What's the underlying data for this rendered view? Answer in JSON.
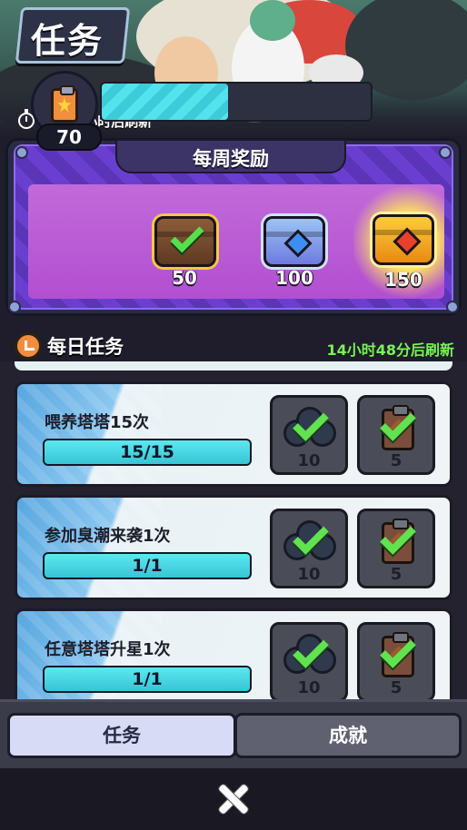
{
  "header": {
    "title": "任务",
    "weekly_refresh": "4天14小时后刷新"
  },
  "weekly_reward": {
    "title": "每周奖励",
    "current_points": "70",
    "progress_fraction": 0.47,
    "milestones": [
      {
        "label": "50",
        "chest": "brown-chest",
        "claimed": true
      },
      {
        "label": "100",
        "chest": "blue-chest",
        "claimed": false
      },
      {
        "label": "150",
        "chest": "gold-chest",
        "claimed": false
      }
    ]
  },
  "daily": {
    "title": "每日任务",
    "refresh": "14小时48分后刷新",
    "tasks": [
      {
        "name": "喂养塔塔15次",
        "progress": "15/15",
        "fraction": 1.0,
        "rewards": [
          {
            "icon": "ball-icon",
            "qty": "10"
          },
          {
            "icon": "clipboard-icon",
            "qty": "5"
          }
        ]
      },
      {
        "name": "参加臭潮来袭1次",
        "progress": "1/1",
        "fraction": 1.0,
        "rewards": [
          {
            "icon": "ball-icon",
            "qty": "10"
          },
          {
            "icon": "clipboard-icon",
            "qty": "5"
          }
        ]
      },
      {
        "name": "任意塔塔升星1次",
        "progress": "1/1",
        "fraction": 1.0,
        "rewards": [
          {
            "icon": "ball-icon",
            "qty": "10"
          },
          {
            "icon": "clipboard-icon",
            "qty": "5"
          }
        ]
      }
    ]
  },
  "tabs": {
    "tasks": "任务",
    "achievements": "成就",
    "active": "tasks"
  },
  "colors": {
    "accent_green": "#7cf25a",
    "progress_cyan": "#3dcbda",
    "panel_purple": "#6a3fd0"
  }
}
